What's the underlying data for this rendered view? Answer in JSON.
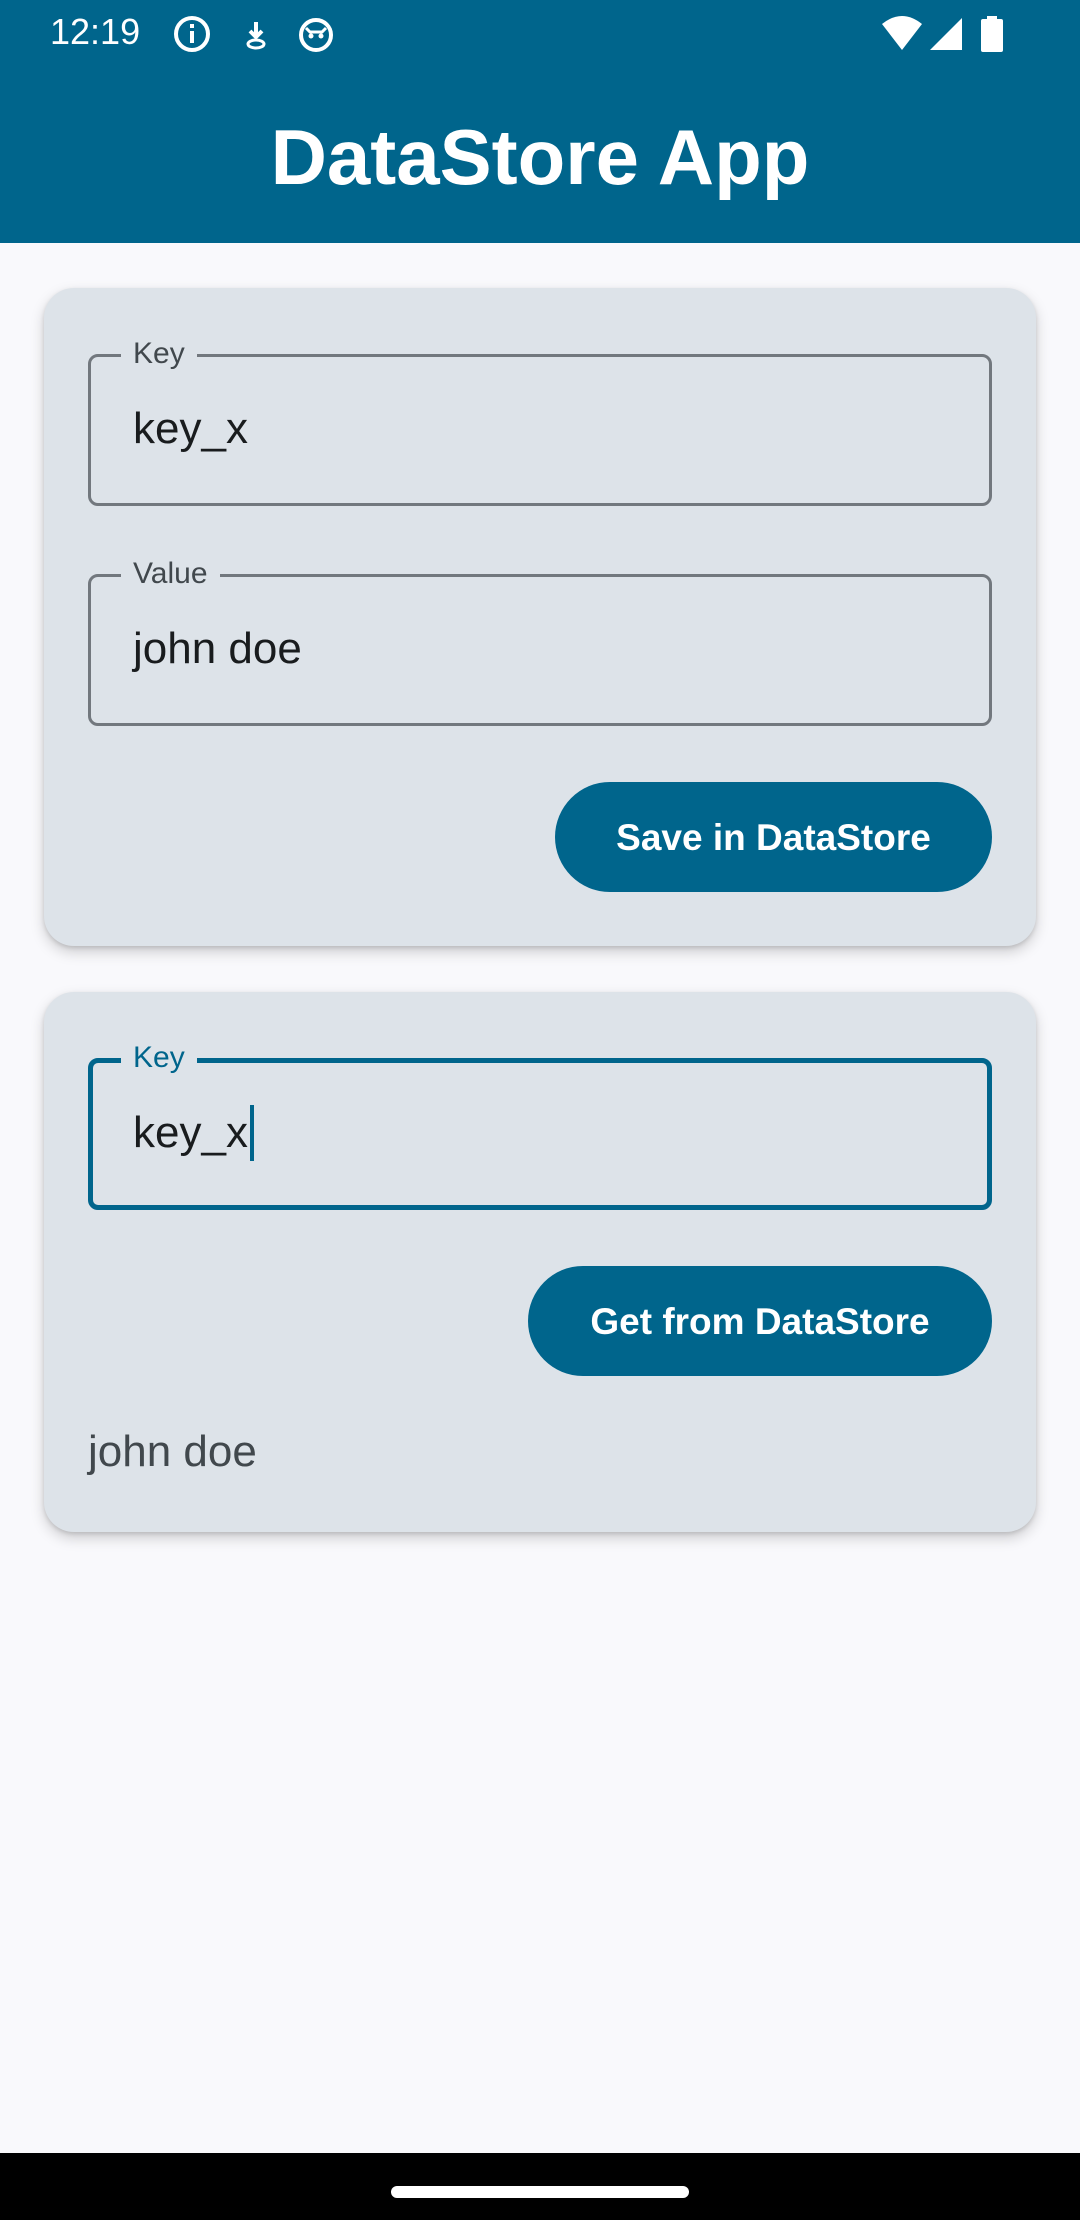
{
  "status_bar": {
    "time": "12:19",
    "left_icons": [
      "info-icon",
      "download-icon",
      "android-debug-icon"
    ],
    "right_icons": [
      "wifi-icon",
      "cell-signal-icon",
      "battery-icon"
    ]
  },
  "app_bar": {
    "title": "DataStore App",
    "color": "#00658c"
  },
  "save_card": {
    "key_field": {
      "label": "Key",
      "value": "key_x"
    },
    "value_field": {
      "label": "Value",
      "value": "john doe"
    },
    "save_button_label": "Save in DataStore"
  },
  "get_card": {
    "key_field": {
      "label": "Key",
      "value": "key_x",
      "focused": true
    },
    "get_button_label": "Get from DataStore",
    "result": "john doe"
  },
  "colors": {
    "primary": "#00658c",
    "card_background": "#dde3e9",
    "page_background": "#f9f9fc"
  }
}
